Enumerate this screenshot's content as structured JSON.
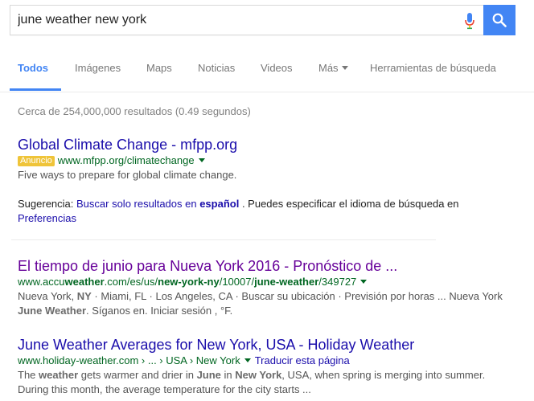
{
  "search": {
    "query": "june weather new york"
  },
  "tabs": [
    {
      "label": "Todos"
    },
    {
      "label": "Imágenes"
    },
    {
      "label": "Maps"
    },
    {
      "label": "Noticias"
    },
    {
      "label": "Videos"
    },
    {
      "label": "Más"
    },
    {
      "label": "Herramientas de búsqueda"
    }
  ],
  "stats": "Cerca de 254,000,000 resultados (0.49 segundos)",
  "ad": {
    "title": "Global Climate Change - mfpp.org",
    "badge": "Anuncio",
    "url": "www.mfpp.org/climatechange",
    "snippet": "Five ways to prepare for global climate change."
  },
  "suggestion": {
    "prefix": "Sugerencia: ",
    "link1": "Buscar solo resultados en ",
    "link1_bold": "español",
    "middle": " . Puedes especificar el idioma de búsqueda en ",
    "link2": "Preferencias"
  },
  "result1": {
    "title": "El tiempo de junio para Nueva York 2016 - Pronóstico de ...",
    "url_parts": [
      "www.accu",
      "weather",
      ".com/es/us/",
      "new-york-ny",
      "/10007/",
      "june-weather",
      "/349727"
    ],
    "snippet_parts": [
      "Nueva York, ",
      "NY",
      " · Miami, FL · Los Angeles, CA · Buscar su ubicación · Previsión por horas ... Nueva York ",
      "June Weather",
      ". Síganos en. Iniciar sesión , °F."
    ]
  },
  "result2": {
    "title": "June Weather Averages for New York, USA - Holiday Weather",
    "url": "www.holiday-weather.com › ... › USA › New York",
    "translate": "Traducir esta página",
    "snippet_parts": [
      "The ",
      "weather",
      " gets warmer and drier in ",
      "June",
      " in ",
      "New York",
      ", USA, when spring is merging into summer. During this month, the average temperature for the city starts ..."
    ]
  },
  "colors": {
    "accent": "#4285f4",
    "link": "#1a0dab",
    "visited": "#660099",
    "url": "#006621",
    "ad_badge": "#efc439"
  }
}
